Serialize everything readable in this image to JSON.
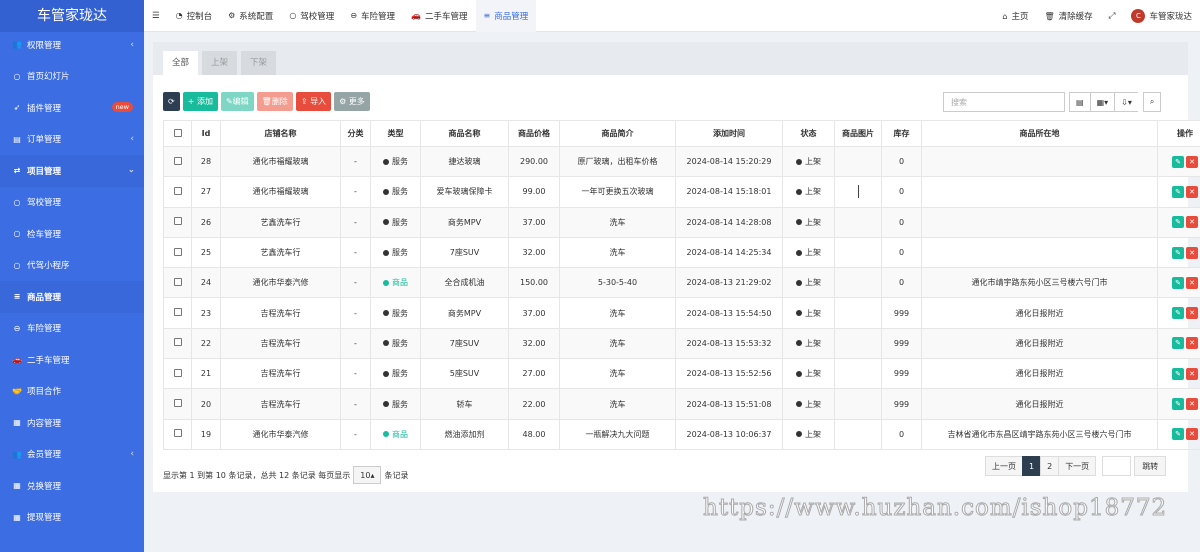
{
  "sidebar": {
    "logo": "车管家珑达",
    "items": [
      {
        "label": "权限管理",
        "icon": "users-icon",
        "caret": "left"
      },
      {
        "label": "首页幻灯片",
        "icon": "circle-icon"
      },
      {
        "label": "插件管理",
        "icon": "rocket-icon",
        "badge": "new"
      },
      {
        "label": "订单管理",
        "icon": "list-icon",
        "caret": "left"
      },
      {
        "label": "项目管理",
        "icon": "exchange-icon",
        "caret": "down",
        "active": true
      },
      {
        "label": "驾校管理",
        "icon": "circle-icon",
        "sub": true
      },
      {
        "label": "检车管理",
        "icon": "circle-icon",
        "sub": true
      },
      {
        "label": "代驾小程序",
        "icon": "circle-icon",
        "sub": true
      },
      {
        "label": "商品管理",
        "icon": "database-icon",
        "sub": true,
        "active": true
      },
      {
        "label": "车险管理",
        "icon": "minus-circle-icon",
        "sub": true
      },
      {
        "label": "二手车管理",
        "icon": "car-icon",
        "sub": true
      },
      {
        "label": "项目合作",
        "icon": "handshake-icon"
      },
      {
        "label": "内容管理",
        "icon": "table-icon"
      },
      {
        "label": "会员管理",
        "icon": "users-icon",
        "caret": "left"
      },
      {
        "label": "兑换管理",
        "icon": "table-icon"
      },
      {
        "label": "提现管理",
        "icon": "table-icon"
      }
    ]
  },
  "topbar": {
    "nav": [
      {
        "label": "控制台",
        "icon": "dashboard-icon"
      },
      {
        "label": "系统配置",
        "icon": "gear-icon"
      },
      {
        "label": "驾校管理",
        "icon": "circle-icon"
      },
      {
        "label": "车险管理",
        "icon": "minus-circle-icon"
      },
      {
        "label": "二手车管理",
        "icon": "car-icon"
      },
      {
        "label": "商品管理",
        "icon": "database-icon",
        "active": true
      }
    ],
    "right": {
      "home": "主页",
      "clear_cache": "清除缓存",
      "user": "车管家珑达"
    }
  },
  "tabs": [
    "全部",
    "上架",
    "下架"
  ],
  "toolbar": {
    "add": "添加",
    "edit": "编辑",
    "delete": "删除",
    "import": "导入",
    "more": "更多"
  },
  "search": {
    "placeholder": "搜索"
  },
  "table": {
    "headers": [
      "Id",
      "店铺名称",
      "分类",
      "类型",
      "商品名称",
      "商品价格",
      "商品简介",
      "添加时间",
      "状态",
      "商品图片",
      "库存",
      "商品所在地",
      "操作"
    ],
    "rows": [
      {
        "id": "28",
        "shop": "通化市福耀玻璃",
        "cat": "-",
        "type": "服务",
        "name": "捷达玻璃",
        "price": "290.00",
        "intro": "原厂玻璃，出租车价格",
        "time": "2024-08-14 15:20:29",
        "status": "上架",
        "img": false,
        "stock": "0",
        "loc": ""
      },
      {
        "id": "27",
        "shop": "通化市福耀玻璃",
        "cat": "-",
        "type": "服务",
        "name": "爱车玻璃保障卡",
        "price": "99.00",
        "intro": "一年可更换五次玻璃",
        "time": "2024-08-14 15:18:01",
        "status": "上架",
        "img": true,
        "stock": "0",
        "loc": ""
      },
      {
        "id": "26",
        "shop": "艺鑫洗车行",
        "cat": "-",
        "type": "服务",
        "name": "商务MPV",
        "price": "37.00",
        "intro": "洗车",
        "time": "2024-08-14 14:28:08",
        "status": "上架",
        "img": false,
        "stock": "0",
        "loc": ""
      },
      {
        "id": "25",
        "shop": "艺鑫洗车行",
        "cat": "-",
        "type": "服务",
        "name": "7座SUV",
        "price": "32.00",
        "intro": "洗车",
        "time": "2024-08-14 14:25:34",
        "status": "上架",
        "img": false,
        "stock": "0",
        "loc": ""
      },
      {
        "id": "24",
        "shop": "通化市华泰汽修",
        "cat": "-",
        "type": "商品",
        "name": "全合成机油",
        "price": "150.00",
        "intro": "5-30-5-40",
        "time": "2024-08-13 21:29:02",
        "status": "上架",
        "img": false,
        "stock": "0",
        "loc": "通化市靖宇路东苑小区三号楼六号门市"
      },
      {
        "id": "23",
        "shop": "吉程洗车行",
        "cat": "-",
        "type": "服务",
        "name": "商务MPV",
        "price": "37.00",
        "intro": "洗车",
        "time": "2024-08-13 15:54:50",
        "status": "上架",
        "img": false,
        "stock": "999",
        "loc": "通化日报附近"
      },
      {
        "id": "22",
        "shop": "吉程洗车行",
        "cat": "-",
        "type": "服务",
        "name": "7座SUV",
        "price": "32.00",
        "intro": "洗车",
        "time": "2024-08-13 15:53:32",
        "status": "上架",
        "img": false,
        "stock": "999",
        "loc": "通化日报附近"
      },
      {
        "id": "21",
        "shop": "吉程洗车行",
        "cat": "-",
        "type": "服务",
        "name": "5座SUV",
        "price": "27.00",
        "intro": "洗车",
        "time": "2024-08-13 15:52:56",
        "status": "上架",
        "img": false,
        "stock": "999",
        "loc": "通化日报附近"
      },
      {
        "id": "20",
        "shop": "吉程洗车行",
        "cat": "-",
        "type": "服务",
        "name": "轿车",
        "price": "22.00",
        "intro": "洗车",
        "time": "2024-08-13 15:51:08",
        "status": "上架",
        "img": false,
        "stock": "999",
        "loc": "通化日报附近"
      },
      {
        "id": "19",
        "shop": "通化市华泰汽修",
        "cat": "-",
        "type": "商品",
        "name": "燃油添加剂",
        "price": "48.00",
        "intro": "一瓶解决九大问题",
        "time": "2024-08-13 10:06:37",
        "status": "上架",
        "img": false,
        "stock": "0",
        "loc": "吉林省通化市东昌区靖宇路东苑小区三号楼六号门市"
      }
    ]
  },
  "footer": {
    "info_prefix": "显示第 1 到第 10 条记录，总共 12 条记录 每页显示",
    "page_size": "10",
    "info_suffix": "条记录"
  },
  "pager": {
    "prev": "上一页",
    "pages": [
      "1",
      "2"
    ],
    "next": "下一页",
    "jump": "跳转"
  },
  "watermark": "https://www.huzhan.com/ishop18772",
  "colors": {
    "sidebar": "#3c6de3",
    "add": "#18bc9c",
    "edit": "#7fd6c4",
    "delete": "#f39c8f",
    "import": "#e74c3c",
    "more": "#95a5a6",
    "refresh": "#2c3e50"
  }
}
